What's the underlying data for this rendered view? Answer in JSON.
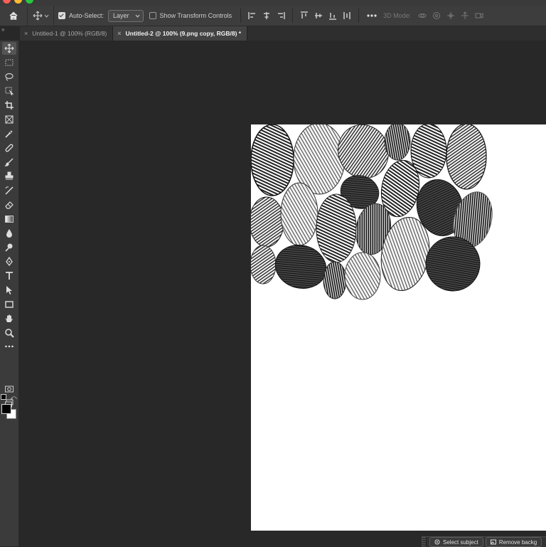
{
  "window": {
    "controls": [
      "close",
      "minimize",
      "maximize"
    ]
  },
  "options_bar": {
    "home_icon": "home-icon",
    "tool_icon": "move-tool-icon",
    "auto_select_label": "Auto-Select:",
    "auto_select_checked": true,
    "auto_select_value": "Layer",
    "show_transform_label": "Show Transform Controls",
    "show_transform_checked": false,
    "mode_label": "3D Mode:"
  },
  "tabs": [
    {
      "label": "Untitled-1 @ 100% (RGB/8)",
      "active": false
    },
    {
      "label": "Untitled-2 @ 100% (9.png copy, RGB/8) *",
      "active": true
    }
  ],
  "toolbar": {
    "tools": [
      "move-icon",
      "marquee-icon",
      "lasso-icon",
      "object-select-icon",
      "crop-icon",
      "frame-icon",
      "eyedropper-icon",
      "healing-brush-icon",
      "brush-icon",
      "stamp-icon",
      "history-brush-icon",
      "eraser-icon",
      "gradient-icon",
      "blur-icon",
      "dodge-icon",
      "pen-icon",
      "type-icon",
      "path-select-icon",
      "rectangle-icon",
      "hand-icon",
      "zoom-icon",
      "more-tools-icon",
      "quick-mask-icon",
      "screen-mode-icon"
    ],
    "foreground_color": "#000000",
    "background_color": "#ffffff"
  },
  "canvas": {
    "background": "#282828",
    "document_color": "#ffffff",
    "content": "fingerprint-collage"
  },
  "contextual_taskbar": {
    "select_subject_label": "Select subject",
    "remove_background_label": "Remove backg"
  }
}
